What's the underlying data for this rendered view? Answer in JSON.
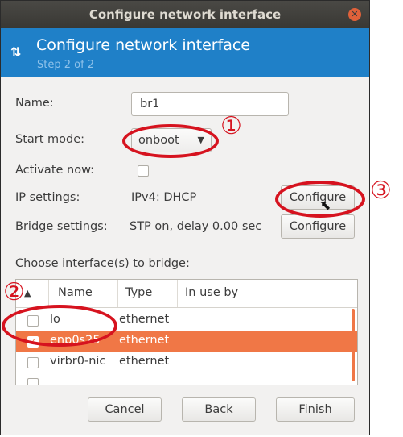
{
  "window": {
    "title": "Configure network interface"
  },
  "header": {
    "title": "Configure network interface",
    "step": "Step 2 of 2",
    "icon": "up-down-arrows-icon"
  },
  "form": {
    "name_label": "Name:",
    "name_value": "br1",
    "start_mode_label": "Start mode:",
    "start_mode_value": "onboot",
    "activate_label": "Activate now:",
    "ip_label": "IP settings:",
    "ip_value": "IPv4: DHCP",
    "ip_button": "Configure",
    "bridge_label": "Bridge settings:",
    "bridge_value": "STP on, delay 0.00 sec",
    "bridge_button": "Configure",
    "choose_label": "Choose interface(s) to bridge:"
  },
  "table": {
    "columns": [
      "Name",
      "Type",
      "In use by"
    ],
    "rows": [
      {
        "name": "lo",
        "type": "ethernet",
        "checked": false
      },
      {
        "name": "enp0s25",
        "type": "ethernet",
        "checked": true,
        "selected": true
      },
      {
        "name": "virbr0-nic",
        "type": "ethernet",
        "checked": false
      }
    ]
  },
  "footer": {
    "cancel": "Cancel",
    "back": "Back",
    "finish": "Finish"
  },
  "annotations": {
    "one": "①",
    "two": "②",
    "three": "③"
  },
  "colors": {
    "accent": "#1f80c8",
    "selection": "#f07746",
    "annotation": "#d6131f"
  }
}
